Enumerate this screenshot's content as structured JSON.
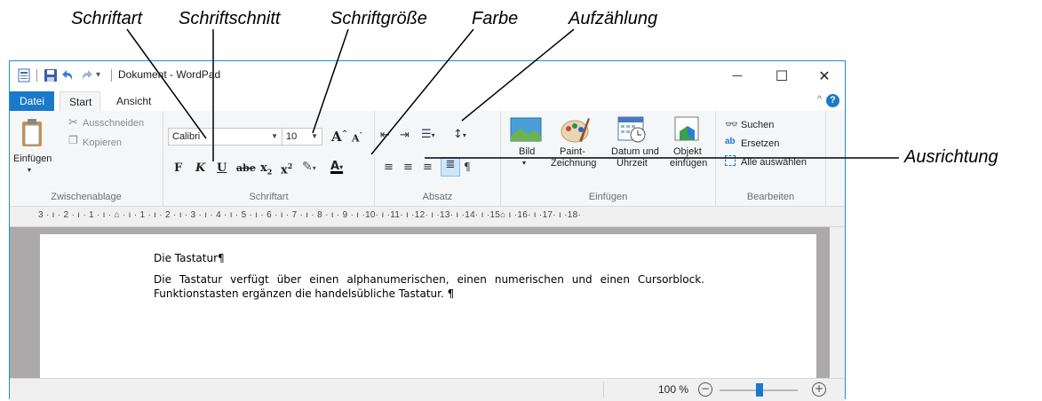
{
  "callouts": {
    "schriftart": "Schriftart",
    "schriftschnitt": "Schriftschnitt",
    "schriftgroesse": "Schriftgröße",
    "farbe": "Farbe",
    "aufzaehlung": "Aufzählung",
    "ausrichtung": "Ausrichtung"
  },
  "window": {
    "title": "Dokument - WordPad",
    "minimize": "—",
    "maximize": "☐",
    "close": "✕"
  },
  "tabs": {
    "file": "Datei",
    "start": "Start",
    "view": "Ansicht",
    "help": "?"
  },
  "ribbon": {
    "clipboard": {
      "paste": "Einfügen",
      "cut": "Ausschneiden",
      "copy": "Kopieren",
      "label": "Zwischenablage"
    },
    "font": {
      "family": "Calibri",
      "size": "10",
      "label": "Schriftart"
    },
    "paragraph": {
      "label": "Absatz"
    },
    "insert": {
      "picture": "Bild",
      "paint_1": "Paint-",
      "paint_2": "Zeichnung",
      "datetime_1": "Datum und",
      "datetime_2": "Uhrzeit",
      "object_1": "Objekt",
      "object_2": "einfügen",
      "label": "Einfügen"
    },
    "editing": {
      "find": "Suchen",
      "replace": "Ersetzen",
      "select_all": "Alle auswählen",
      "label": "Bearbeiten"
    }
  },
  "ruler": {
    "text": "3 · ı · 2 · ı · 1 · ı · ⌂ · ı · 1 · ı · 2 · ı · 3 · ı · 4 · ı · 5 · ı · 6 · ı · 7 · ı · 8 · ı · 9 · ı ·10· ı ·11· ı ·12· ı ·13· ı ·14· ı ·15⌂ ı ·16· ı ·17· ı ·18·"
  },
  "document": {
    "title": "Die Tastatur¶",
    "body": "Die Tastatur verfügt über einen alphanumerischen, einen numerischen und einen Cursorblock. Funktionstasten ergänzen die handelsübliche Tastatur. ¶"
  },
  "status": {
    "zoom": "100 %",
    "zoom_out": "−",
    "zoom_in": "+",
    "zoom_level": 100
  },
  "colors": {
    "accent": "#1979ca",
    "window_border": "#1e8fd6",
    "ribbon_bg": "#f5f6f7",
    "doc_bg": "#aba9aa"
  }
}
